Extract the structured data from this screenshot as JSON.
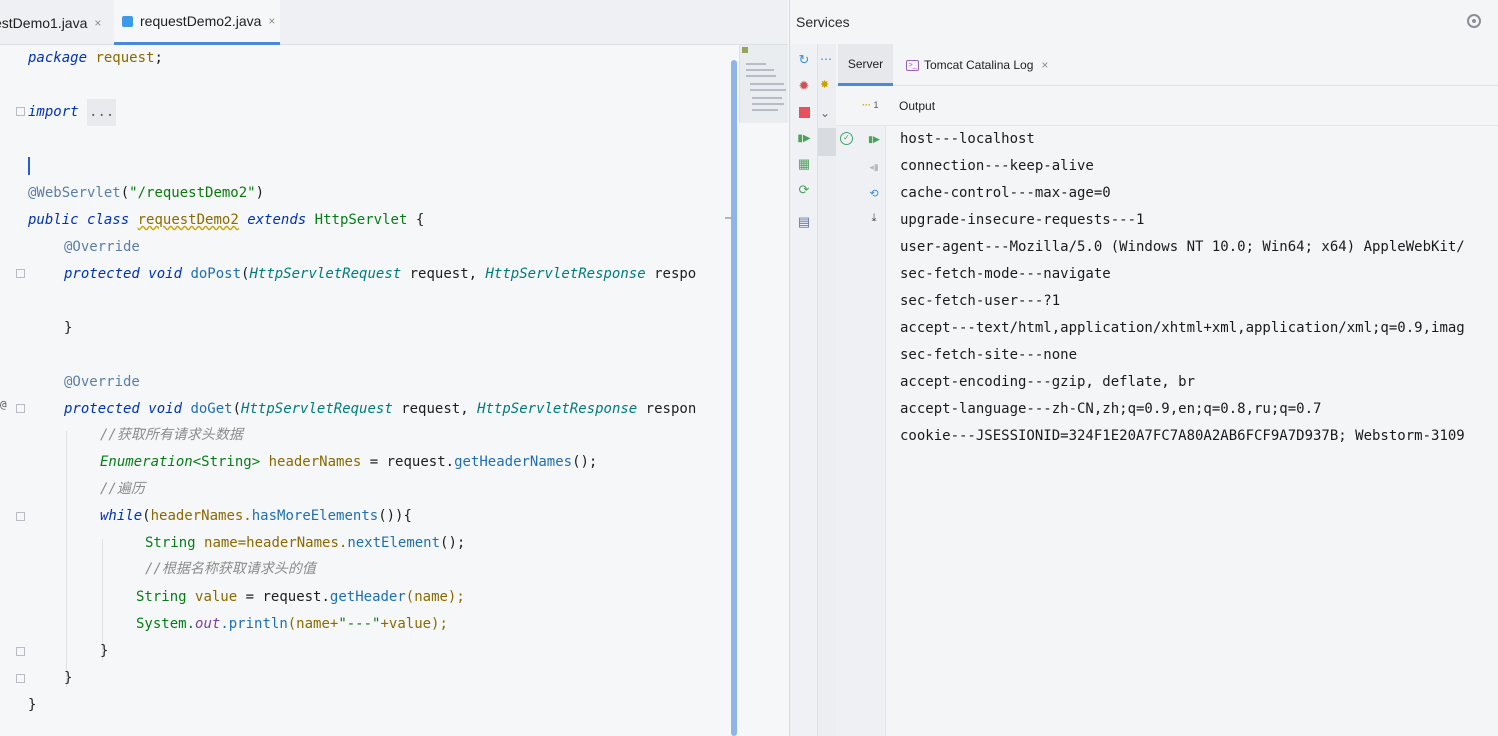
{
  "editor": {
    "tabs": [
      {
        "label": "estDemo1.java",
        "close": "×"
      },
      {
        "label": "requestDemo2.java",
        "close": "×",
        "active": true
      }
    ],
    "code": {
      "package_kw": "package",
      "package_name": "request",
      "semicolon": ";",
      "import_kw": "import",
      "import_fold": "...",
      "annotation_webservlet": "@WebServlet",
      "webservlet_open": "(",
      "webservlet_path": "\"/requestDemo2\"",
      "webservlet_close": ")",
      "public_kw": "public",
      "class_kw": "class",
      "class_name": "requestDemo2",
      "extends_kw": "extends",
      "superclass": "HttpServlet",
      "open_brace": "{",
      "override": "@Override",
      "protected_kw": "protected",
      "void_kw": "void",
      "dopost": "doPost",
      "doget": "doGet",
      "paren_open": "(",
      "req_type": "HttpServletRequest",
      "req_name": "request,",
      "resp_type": "HttpServletResponse",
      "resp_name_post": "respo",
      "resp_name_get": "respon",
      "close_brace": "}",
      "comment_get_all": "//获取所有请求头数据",
      "enum_type": "Enumeration",
      "enum_generic": "<String>",
      "header_names_decl": "headerNames",
      "assign": "=",
      "request_obj": "request.",
      "get_header_names": "getHeaderNames",
      "call_end": "();",
      "comment_iterate": "//遍历",
      "while_kw": "while",
      "while_open": "(",
      "header_names_ref": "headerNames.",
      "has_more": "hasMoreElements",
      "while_tail": "()){",
      "string_type": "String",
      "name_assign": "name=",
      "header_names_ref2": "headerNames.",
      "next_element": "nextElement",
      "comment_by_name": "//根据名称获取请求头的值",
      "value_decl": "value",
      "get_header": "getHeader",
      "name_arg": "(name);",
      "system": "System.",
      "out": "out",
      "println": ".println",
      "println_args_1": "(name+",
      "dash_str": "\"---\"",
      "println_args_2": "+value);"
    }
  },
  "services": {
    "title": "Services",
    "settings_icon": "target-icon",
    "tabs": [
      {
        "label": "Server"
      },
      {
        "label": "Tomcat Catalina Log",
        "close": "×"
      }
    ],
    "output_count": "1",
    "output_label": "Output",
    "output_lines": [
      "host---localhost",
      "connection---keep-alive",
      "cache-control---max-age=0",
      "upgrade-insecure-requests---1",
      "user-agent---Mozilla/5.0 (Windows NT 10.0; Win64; x64) AppleWebKit/",
      "sec-fetch-mode---navigate",
      "sec-fetch-user---?1",
      "accept---text/html,application/xhtml+xml,application/xml;q=0.9,imag",
      "sec-fetch-site---none",
      "accept-encoding---gzip, deflate, br",
      "accept-language---zh-CN,zh;q=0.9,en;q=0.8,ru;q=0.7",
      "cookie---JSESSIONID=324F1E20A7FC7A80A2AB6FCF9A7D937B; Webstorm-3109"
    ]
  }
}
